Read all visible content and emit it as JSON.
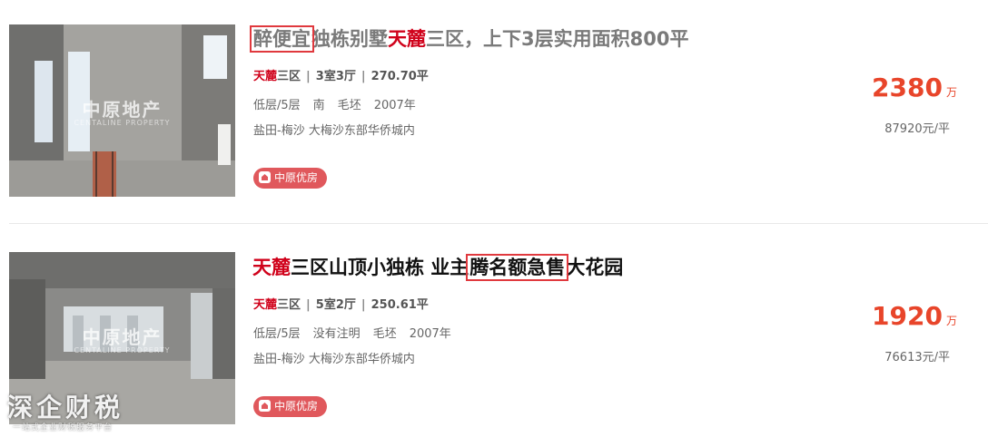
{
  "listings": [
    {
      "title": {
        "boxed": "醉便宜",
        "mid1": "独栋别墅",
        "red": "天麓",
        "rest": "三区，上下3层实用面积800平"
      },
      "community_red": "天麓",
      "community_rest": "三区",
      "layout": "3室3厅",
      "area": "270.70平",
      "floor": "低层/5层",
      "orientation": "南",
      "decoration": "毛坯",
      "year": "2007年",
      "location": "盐田-梅沙 大梅沙东部华侨城内",
      "badge": "中原优房",
      "price": "2380",
      "price_unit": "万",
      "unit_price": "87920元/平",
      "photo_watermark": "中原地产",
      "photo_watermark_sub": "CENTALINE PROPERTY"
    },
    {
      "title": {
        "red": "天麓",
        "mid1": "三区山顶小独栋 业主",
        "boxed": "腾名额急售",
        "rest": "大花园"
      },
      "community_red": "天麓",
      "community_rest": "三区",
      "layout": "5室2厅",
      "area": "250.61平",
      "floor": "低层/5层",
      "orientation": "没有注明",
      "decoration": "毛坯",
      "year": "2007年",
      "location": "盐田-梅沙 大梅沙东部华侨城内",
      "badge": "中原优房",
      "price": "1920",
      "price_unit": "万",
      "unit_price": "76613元/平",
      "photo_watermark": "中原地产",
      "photo_watermark_sub": "CENTALINE PROPERTY"
    }
  ],
  "separator": "|",
  "corner_watermark": "深企财税",
  "corner_watermark_sub": "一站式企业财税服务平台",
  "colors": {
    "accent_red": "#d0021b",
    "price": "#e8452a",
    "badge": "#e0585c",
    "box_outline": "#e0393e"
  }
}
